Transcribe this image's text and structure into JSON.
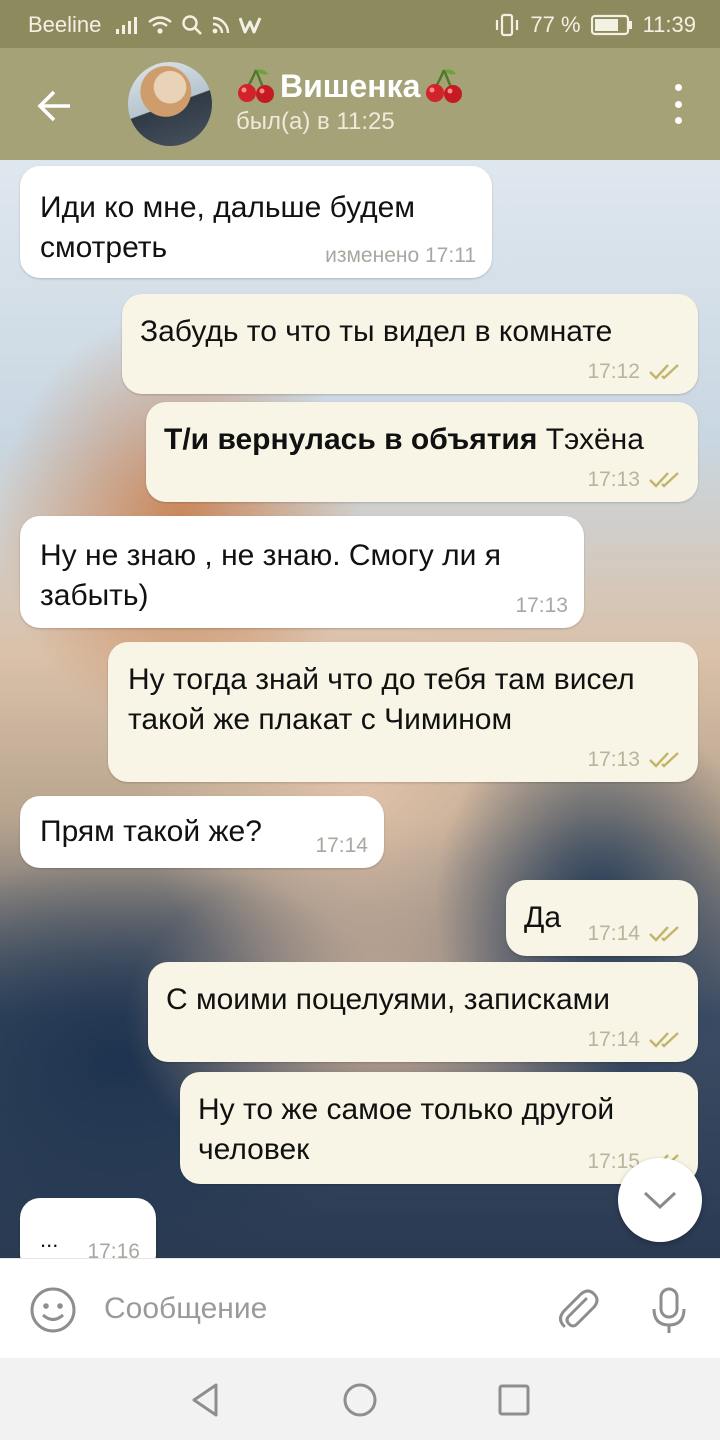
{
  "status_bar": {
    "carrier": "Beeline",
    "battery": "77 %",
    "time": "11:39"
  },
  "header": {
    "contact_name": "Вишенка",
    "status": "был(а) в 11:25",
    "name_emoji": "cherry-icon"
  },
  "messages": [
    {
      "side": "in",
      "text": "Иди ко мне, дальше будем смотреть",
      "time": "изменено 17:11"
    },
    {
      "side": "out",
      "text": "Забудь то что ты видел в комнате",
      "time": "17:12",
      "read": true
    },
    {
      "side": "out",
      "text_bold": "Т/и вернулась в объятия",
      "text_rest": " Тэхёна",
      "time": "17:13",
      "read": true
    },
    {
      "side": "in",
      "text": "Ну не знаю , не знаю. Смогу ли я забыть)",
      "time": "17:13"
    },
    {
      "side": "out",
      "text": "Ну тогда знай что до тебя там висел такой же плакат с Чимином",
      "time": "17:13",
      "read": true
    },
    {
      "side": "in",
      "text": "Прям такой же?",
      "time": "17:14"
    },
    {
      "side": "out",
      "text": "Да",
      "time": "17:14",
      "read": true
    },
    {
      "side": "out",
      "text": "С моими поцелуями, записками",
      "time": "17:14",
      "read": true
    },
    {
      "side": "out",
      "text": "Ну то же самое только другой человек",
      "time": "17:15",
      "read": true
    },
    {
      "side": "in",
      "text": "...",
      "time": "17:16"
    }
  ],
  "composer": {
    "placeholder": "Сообщение"
  },
  "colors": {
    "header_bg": "#a5a277",
    "status_bg": "#8d8a5e",
    "bubble_in": "#ffffff",
    "bubble_out": "#f8f5e6",
    "check_color": "#c2b56a"
  }
}
